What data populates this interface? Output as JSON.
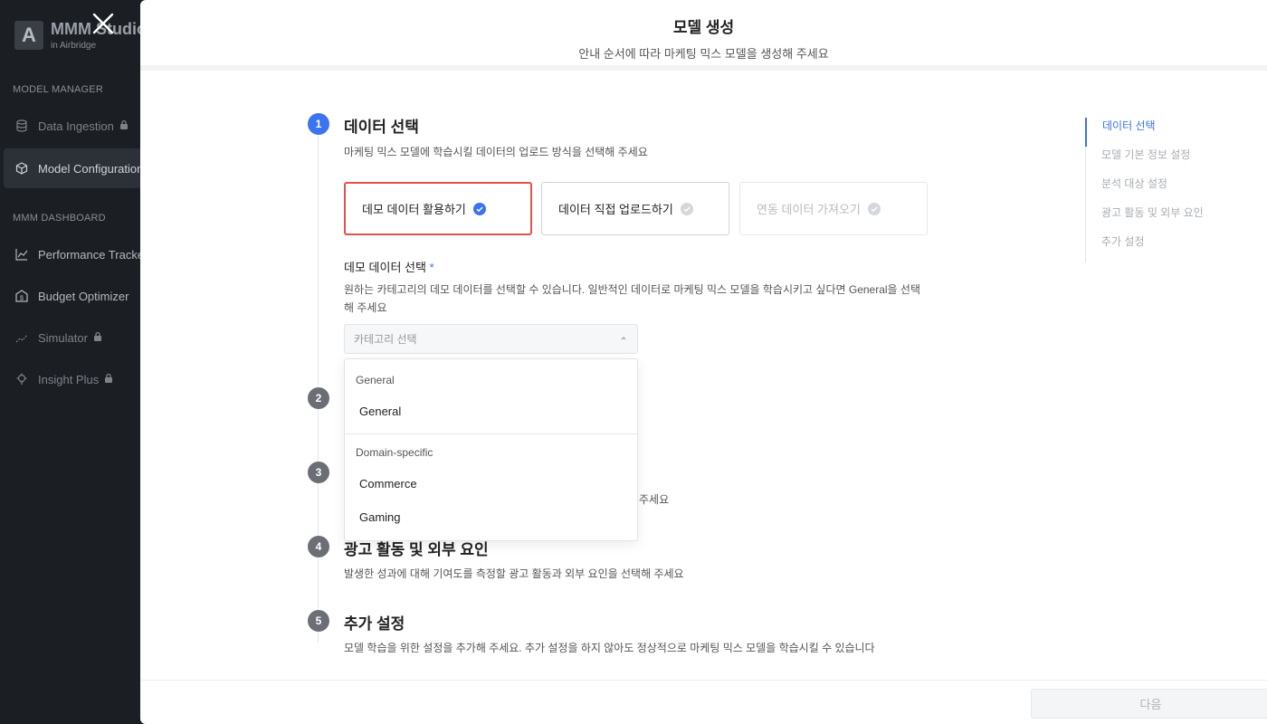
{
  "sidebar": {
    "brand_letter": "A",
    "brand_name": "MMM Studio",
    "brand_sub": "in Airbridge",
    "sections": [
      {
        "label": "MODEL MANAGER"
      },
      {
        "label": "MMM DASHBOARD"
      }
    ],
    "items": [
      {
        "label": "Data Ingestion",
        "icon": "database-icon",
        "locked": true
      },
      {
        "label": "Model Configuration",
        "icon": "cube-icon",
        "locked": false
      },
      {
        "label": "Performance Tracker",
        "icon": "chart-icon",
        "locked": false
      },
      {
        "label": "Budget Optimizer",
        "icon": "dollar-icon",
        "locked": false
      },
      {
        "label": "Simulator",
        "icon": "trend-icon",
        "locked": true
      },
      {
        "label": "Insight Plus",
        "icon": "bulb-icon",
        "locked": true
      }
    ]
  },
  "modal": {
    "title": "모델 생성",
    "subtitle": "안내 순서에 따라 마케팅 믹스 모델을 생성해 주세요",
    "steps": [
      {
        "num": "1",
        "title": "데이터 선택",
        "desc": "마케팅 믹스 모델에 학습시킬 데이터의 업로드 방식을 선택해 주세요"
      },
      {
        "num": "2",
        "title": "",
        "desc": ""
      },
      {
        "num": "3",
        "title": "",
        "desc": "주세요"
      },
      {
        "num": "4",
        "title": "광고 활동 및 외부 요인",
        "desc": "발생한 성과에 대해 기여도를 측정할 광고 활동과 외부 요인을 선택해 주세요"
      },
      {
        "num": "5",
        "title": "추가 설정",
        "desc": "모델 학습을 위한 설정을 추가해 주세요. 추가 설정을 하지 않아도 정상적으로 마케팅 믹스 모델을 학습시킬 수 있습니다"
      }
    ],
    "options": [
      {
        "label": "데모 데이터 활용하기"
      },
      {
        "label": "데이터 직접 업로드하기"
      },
      {
        "label": "연동 데이터 가져오기"
      }
    ],
    "demo_field": {
      "label": "데모 데이터 선택",
      "required_mark": "*",
      "help": "원하는 카테고리의 데모 데이터를 선택할 수 있습니다. 일반적인 데이터로 마케팅 믹스 모델을 학습시키고 싶다면 General을 선택해 주세요",
      "placeholder": "카테고리 선택"
    },
    "dropdown": {
      "groups": [
        {
          "label": "General",
          "items": [
            "General"
          ]
        },
        {
          "label": "Domain-specific",
          "items": [
            "Commerce",
            "Gaming"
          ]
        }
      ]
    },
    "toc": [
      "데이터 선택",
      "모델 기본 정보 설정",
      "분석 대상 설정",
      "광고 활동 및 외부 요인",
      "추가 설정"
    ],
    "next_label": "다음"
  },
  "colors": {
    "accent": "#3b73f0",
    "selected_border": "#e0524d",
    "sidebar_bg": "#1b1e23"
  }
}
